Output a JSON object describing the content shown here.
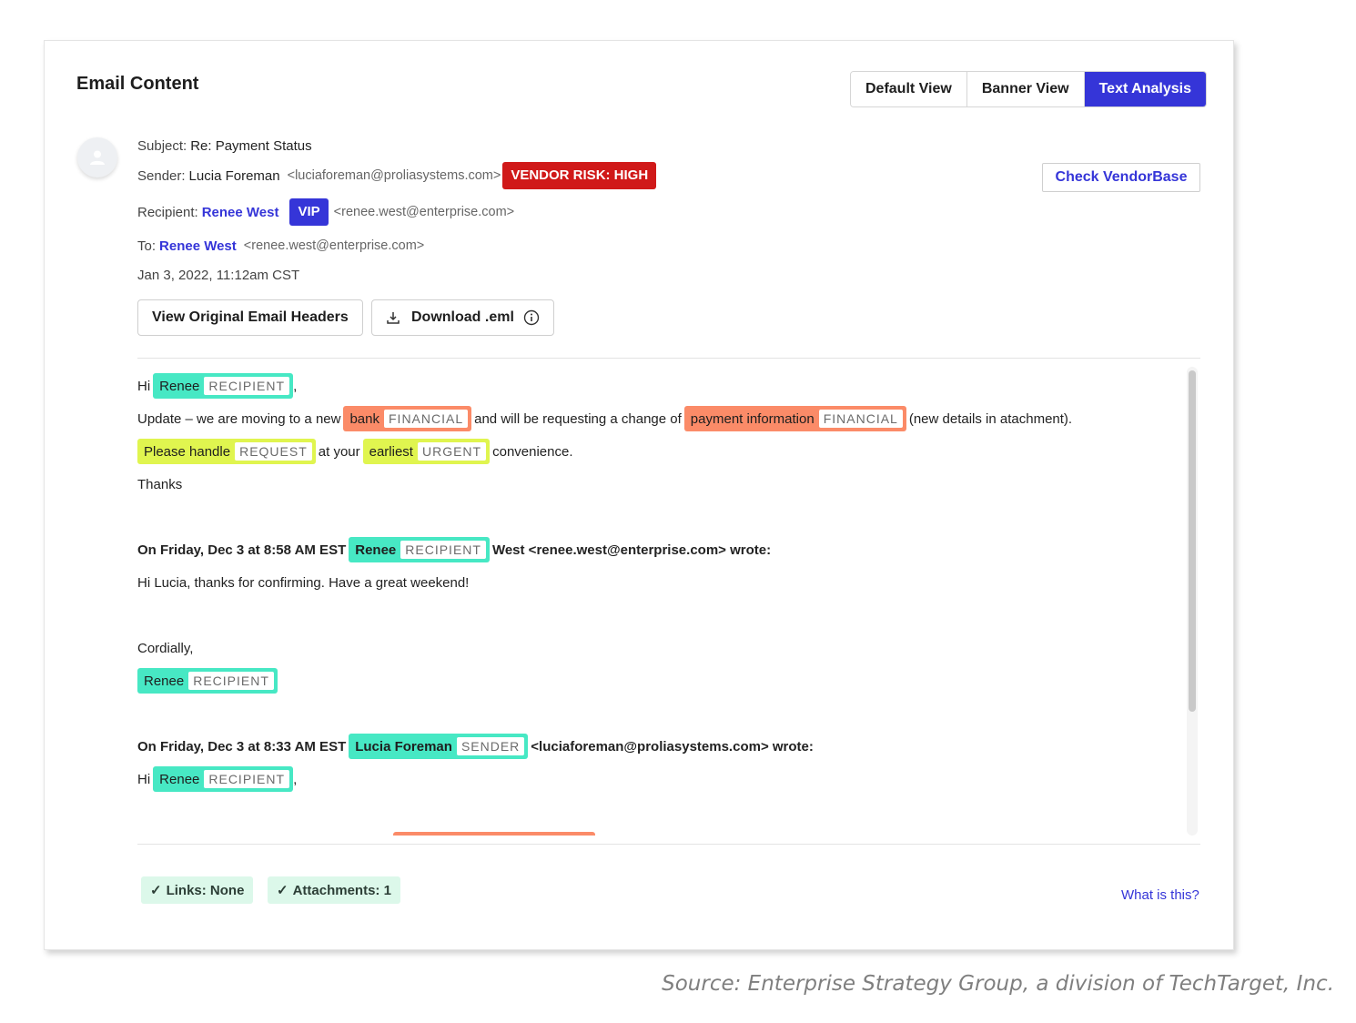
{
  "card": {
    "title": "Email Content",
    "view_tabs": [
      {
        "label": "Default View",
        "active": false
      },
      {
        "label": "Banner View",
        "active": false
      },
      {
        "label": "Text Analysis",
        "active": true
      }
    ]
  },
  "header": {
    "subject_label": "Subject:",
    "subject": "Re: Payment Status",
    "sender_label": "Sender:",
    "sender_name": "Lucia Foreman",
    "sender_email": "<luciaforeman@proliasystems.com>",
    "vendor_risk": "VENDOR RISK: HIGH",
    "recipient_label": "Recipient:",
    "recipient_name": "Renee West",
    "vip_badge": "VIP",
    "recipient_email": "<renee.west@enterprise.com>",
    "to_label": "To:",
    "to_name": "Renee West",
    "to_email": "<renee.west@enterprise.com>",
    "date": "Jan 3, 2022, 11:12am CST",
    "check_vendor_label": "Check VendorBase",
    "view_headers_label": "View Original Email Headers",
    "download_label": "Download .eml"
  },
  "body": {
    "hi": "Hi",
    "comma": ",",
    "tag_renee": "Renee",
    "cat_recipient": "RECIPIENT",
    "line2_a": "Update – we are moving to a new",
    "tag_bank": "bank",
    "cat_financial": "FINANCIAL",
    "line2_b": "and will be requesting a change of",
    "tag_payment": "payment information",
    "line2_c": "(new details in atachment).",
    "tag_please": "Please handle",
    "cat_request": "REQUEST",
    "line3_a": "at your",
    "tag_earliest": "earliest",
    "cat_urgent": "URGENT",
    "line3_b": "convenience.",
    "thanks": "Thanks",
    "q1_prefix": "On Friday, Dec 3 at 8:58 AM EST",
    "q1_suffix": "West <renee.west@enterprise.com> wrote:",
    "q1_body": "Hi Lucia, thanks for confirming. Have a great weekend!",
    "cordially": "Cordially,",
    "q2_prefix": "On Friday, Dec 3 at 8:33 AM EST",
    "tag_lucia": "Lucia Foreman",
    "cat_sender": "SENDER",
    "q2_suffix": "<luciaforeman@proliasystems.com> wrote:"
  },
  "footer": {
    "links_pill": "Links: None",
    "attachments_pill": "Attachments: 1",
    "what_is_this": "What is this?"
  },
  "source_note": "Source: Enterprise Strategy Group, a division of TechTarget, Inc.",
  "colors": {
    "accent": "#3535d8",
    "risk_red": "#d01919",
    "tag_green": "#47e8c4",
    "tag_orange": "#fb8b68",
    "tag_yellow": "#e0f54f",
    "pill_green": "#dcf8ea"
  }
}
